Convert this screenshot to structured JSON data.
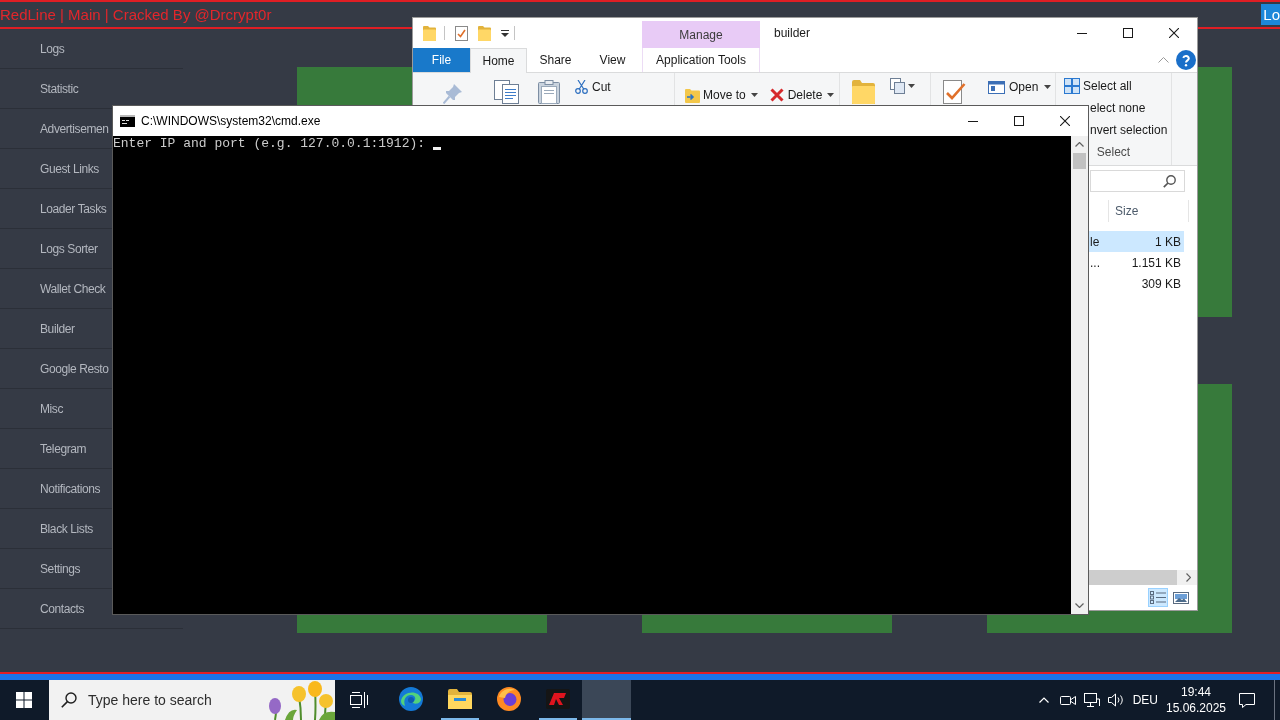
{
  "app": {
    "title": "RedLine | Main | Cracked By @Drcrypt0r",
    "corner_button": "Lo",
    "sidebar": {
      "items": [
        {
          "label": "Logs"
        },
        {
          "label": "Statistic"
        },
        {
          "label": "Advertisemen"
        },
        {
          "label": "Guest Links"
        },
        {
          "label": "Loader Tasks"
        },
        {
          "label": "Logs Sorter"
        },
        {
          "label": "Wallet Check"
        },
        {
          "label": "Builder"
        },
        {
          "label": "Google Resto"
        },
        {
          "label": "Misc"
        },
        {
          "label": "Telegram"
        },
        {
          "label": "Notifications"
        },
        {
          "label": "Black Lists"
        },
        {
          "label": "Settings"
        },
        {
          "label": "Contacts"
        }
      ]
    }
  },
  "explorer": {
    "tool_group": "Manage",
    "title": "builder",
    "tabs": [
      {
        "label": "File",
        "kind": "file",
        "selected": false
      },
      {
        "label": "Home",
        "kind": "tab",
        "selected": true
      },
      {
        "label": "Share",
        "kind": "tab",
        "selected": false
      },
      {
        "label": "View",
        "kind": "tab",
        "selected": false
      },
      {
        "label": "Application Tools",
        "kind": "tool",
        "selected": false
      }
    ],
    "ribbon": {
      "cut": "Cut",
      "move_to": "Move to",
      "delete": "Delete",
      "open": "Open",
      "select_all": "Select all",
      "select_none": "elect none",
      "invert_selection": "nvert selection",
      "select_group": "Select"
    },
    "columns": [
      "Size"
    ],
    "files": [
      {
        "name": "le",
        "size": "1 KB",
        "selected": true
      },
      {
        "name": "...",
        "size": "1.151 KB",
        "selected": false
      },
      {
        "size": "309 KB",
        "selected": false
      }
    ],
    "view_buttons": [
      {
        "kind": "details",
        "selected": true
      },
      {
        "kind": "large_icons",
        "selected": false
      }
    ]
  },
  "console": {
    "title": "C:\\WINDOWS\\system32\\cmd.exe",
    "lines": [
      "Enter IP and port (e.g. 127.0.0.1:1912):"
    ]
  },
  "taskbar": {
    "search": {
      "placeholder": "Type here to search"
    },
    "apps": [
      {
        "running": false,
        "active": false
      },
      {
        "running": true,
        "active": false
      },
      {
        "running": false,
        "active": false
      },
      {
        "running": true,
        "active": false
      },
      {
        "running": true,
        "active": true
      }
    ],
    "language": "DEU",
    "time": "19:44",
    "date": "15.06.2025"
  }
}
